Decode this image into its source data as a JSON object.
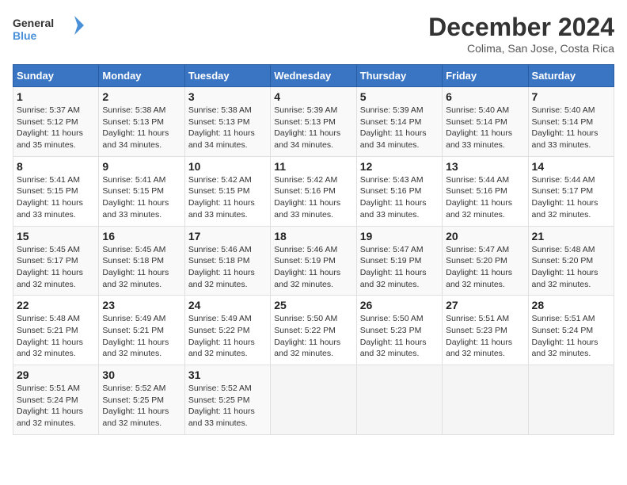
{
  "logo": {
    "text_general": "General",
    "text_blue": "Blue"
  },
  "title": "December 2024",
  "subtitle": "Colima, San Jose, Costa Rica",
  "days_of_week": [
    "Sunday",
    "Monday",
    "Tuesday",
    "Wednesday",
    "Thursday",
    "Friday",
    "Saturday"
  ],
  "weeks": [
    [
      {
        "day": "1",
        "info": "Sunrise: 5:37 AM\nSunset: 5:12 PM\nDaylight: 11 hours\nand 35 minutes."
      },
      {
        "day": "2",
        "info": "Sunrise: 5:38 AM\nSunset: 5:13 PM\nDaylight: 11 hours\nand 34 minutes."
      },
      {
        "day": "3",
        "info": "Sunrise: 5:38 AM\nSunset: 5:13 PM\nDaylight: 11 hours\nand 34 minutes."
      },
      {
        "day": "4",
        "info": "Sunrise: 5:39 AM\nSunset: 5:13 PM\nDaylight: 11 hours\nand 34 minutes."
      },
      {
        "day": "5",
        "info": "Sunrise: 5:39 AM\nSunset: 5:14 PM\nDaylight: 11 hours\nand 34 minutes."
      },
      {
        "day": "6",
        "info": "Sunrise: 5:40 AM\nSunset: 5:14 PM\nDaylight: 11 hours\nand 33 minutes."
      },
      {
        "day": "7",
        "info": "Sunrise: 5:40 AM\nSunset: 5:14 PM\nDaylight: 11 hours\nand 33 minutes."
      }
    ],
    [
      {
        "day": "8",
        "info": "Sunrise: 5:41 AM\nSunset: 5:15 PM\nDaylight: 11 hours\nand 33 minutes."
      },
      {
        "day": "9",
        "info": "Sunrise: 5:41 AM\nSunset: 5:15 PM\nDaylight: 11 hours\nand 33 minutes."
      },
      {
        "day": "10",
        "info": "Sunrise: 5:42 AM\nSunset: 5:15 PM\nDaylight: 11 hours\nand 33 minutes."
      },
      {
        "day": "11",
        "info": "Sunrise: 5:42 AM\nSunset: 5:16 PM\nDaylight: 11 hours\nand 33 minutes."
      },
      {
        "day": "12",
        "info": "Sunrise: 5:43 AM\nSunset: 5:16 PM\nDaylight: 11 hours\nand 33 minutes."
      },
      {
        "day": "13",
        "info": "Sunrise: 5:44 AM\nSunset: 5:16 PM\nDaylight: 11 hours\nand 32 minutes."
      },
      {
        "day": "14",
        "info": "Sunrise: 5:44 AM\nSunset: 5:17 PM\nDaylight: 11 hours\nand 32 minutes."
      }
    ],
    [
      {
        "day": "15",
        "info": "Sunrise: 5:45 AM\nSunset: 5:17 PM\nDaylight: 11 hours\nand 32 minutes."
      },
      {
        "day": "16",
        "info": "Sunrise: 5:45 AM\nSunset: 5:18 PM\nDaylight: 11 hours\nand 32 minutes."
      },
      {
        "day": "17",
        "info": "Sunrise: 5:46 AM\nSunset: 5:18 PM\nDaylight: 11 hours\nand 32 minutes."
      },
      {
        "day": "18",
        "info": "Sunrise: 5:46 AM\nSunset: 5:19 PM\nDaylight: 11 hours\nand 32 minutes."
      },
      {
        "day": "19",
        "info": "Sunrise: 5:47 AM\nSunset: 5:19 PM\nDaylight: 11 hours\nand 32 minutes."
      },
      {
        "day": "20",
        "info": "Sunrise: 5:47 AM\nSunset: 5:20 PM\nDaylight: 11 hours\nand 32 minutes."
      },
      {
        "day": "21",
        "info": "Sunrise: 5:48 AM\nSunset: 5:20 PM\nDaylight: 11 hours\nand 32 minutes."
      }
    ],
    [
      {
        "day": "22",
        "info": "Sunrise: 5:48 AM\nSunset: 5:21 PM\nDaylight: 11 hours\nand 32 minutes."
      },
      {
        "day": "23",
        "info": "Sunrise: 5:49 AM\nSunset: 5:21 PM\nDaylight: 11 hours\nand 32 minutes."
      },
      {
        "day": "24",
        "info": "Sunrise: 5:49 AM\nSunset: 5:22 PM\nDaylight: 11 hours\nand 32 minutes."
      },
      {
        "day": "25",
        "info": "Sunrise: 5:50 AM\nSunset: 5:22 PM\nDaylight: 11 hours\nand 32 minutes."
      },
      {
        "day": "26",
        "info": "Sunrise: 5:50 AM\nSunset: 5:23 PM\nDaylight: 11 hours\nand 32 minutes."
      },
      {
        "day": "27",
        "info": "Sunrise: 5:51 AM\nSunset: 5:23 PM\nDaylight: 11 hours\nand 32 minutes."
      },
      {
        "day": "28",
        "info": "Sunrise: 5:51 AM\nSunset: 5:24 PM\nDaylight: 11 hours\nand 32 minutes."
      }
    ],
    [
      {
        "day": "29",
        "info": "Sunrise: 5:51 AM\nSunset: 5:24 PM\nDaylight: 11 hours\nand 32 minutes."
      },
      {
        "day": "30",
        "info": "Sunrise: 5:52 AM\nSunset: 5:25 PM\nDaylight: 11 hours\nand 32 minutes."
      },
      {
        "day": "31",
        "info": "Sunrise: 5:52 AM\nSunset: 5:25 PM\nDaylight: 11 hours\nand 33 minutes."
      },
      {
        "day": "",
        "info": ""
      },
      {
        "day": "",
        "info": ""
      },
      {
        "day": "",
        "info": ""
      },
      {
        "day": "",
        "info": ""
      }
    ]
  ]
}
